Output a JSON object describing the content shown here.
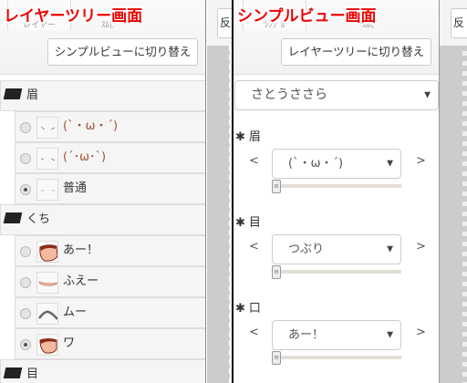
{
  "layer_tree_panel": {
    "overlay_title": "レイヤーツリー画面",
    "tabs": [
      "レイヤー",
      "ｽﾙﾋﾞ"
    ],
    "switch_button": "シンプルビューに切り替え",
    "groups": [
      {
        "name": "眉",
        "items": [
          {
            "label": "(`・ω・´)",
            "selected": false
          },
          {
            "label": "(´･ω･`)",
            "selected": false
          },
          {
            "label": "普通",
            "selected": true
          }
        ]
      },
      {
        "name": "くち",
        "items": [
          {
            "label": "あー！",
            "selected": false
          },
          {
            "label": "ふえー",
            "selected": false
          },
          {
            "label": "ムー",
            "selected": false
          },
          {
            "label": "ワ",
            "selected": true
          }
        ]
      },
      {
        "name": "目",
        "items": []
      }
    ],
    "side_button": "反"
  },
  "simple_view_panel": {
    "overlay_title": "シンプルビュー画面",
    "tabs": [
      "ｼﾝﾌﾟﾙ",
      "ｽﾙﾋﾞ"
    ],
    "switch_button": "レイヤーツリーに切り替え",
    "character_select": "さとうささら",
    "prev_label": "<",
    "next_label": ">",
    "sections": [
      {
        "name": "眉",
        "value": "(`・ω・´)",
        "slider": 0
      },
      {
        "name": "目",
        "value": "つぶり",
        "slider": 0
      },
      {
        "name": "口",
        "value": "あー！",
        "slider": 0
      }
    ],
    "side_button": "反"
  },
  "icons": {
    "group": "folder-open-icon",
    "section": "asterisk-icon",
    "dropdown": "caret-down-icon"
  }
}
